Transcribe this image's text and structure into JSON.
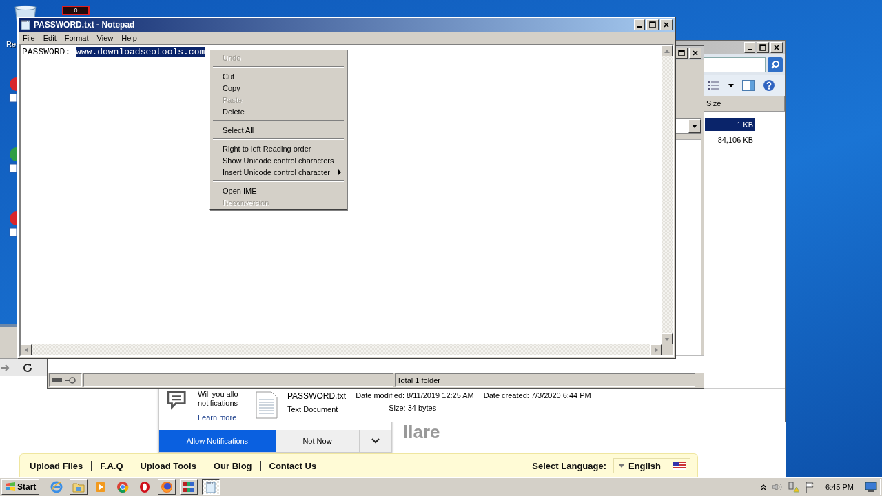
{
  "desktop": {
    "icon_label": "Re",
    "counter": "0"
  },
  "browser": {
    "notification": {
      "lines": [
        "Will you allo",
        "notifications"
      ],
      "link": "Learn more",
      "allow": "Allow Notifications",
      "dismiss": "Not Now"
    },
    "logo_fragment": "llare",
    "nav_links": [
      "Upload Files",
      "F.A.Q",
      "Upload Tools",
      "Our Blog",
      "Contact Us"
    ],
    "language_label": "Select Language:",
    "language": "English"
  },
  "explorer": {
    "column": "Size",
    "rows": [
      {
        "size": "1 KB",
        "selected": true
      },
      {
        "size": "84,106 KB",
        "selected": false
      }
    ],
    "details": {
      "name": "PASSWORD.txt",
      "type": "Text Document",
      "modified": "Date modified: 8/11/2019 12:25 AM",
      "created": "Date created: 7/3/2020 6:44 PM",
      "size": "Size: 34 bytes"
    }
  },
  "folder_window": {
    "status": "Total 1 folder"
  },
  "notepad": {
    "title": "PASSWORD.txt - Notepad",
    "menu": [
      "File",
      "Edit",
      "Format",
      "View",
      "Help"
    ],
    "text": "PASSWORD: ",
    "selection": "www.downloadseotools.com"
  },
  "context_menu": {
    "groups": [
      [
        {
          "label": "Undo",
          "disabled": true,
          "submenu": false
        }
      ],
      [
        {
          "label": "Cut",
          "disabled": false,
          "submenu": false
        },
        {
          "label": "Copy",
          "disabled": false,
          "submenu": false
        },
        {
          "label": "Paste",
          "disabled": true,
          "submenu": false
        },
        {
          "label": "Delete",
          "disabled": false,
          "submenu": false
        }
      ],
      [
        {
          "label": "Select All",
          "disabled": false,
          "submenu": false
        }
      ],
      [
        {
          "label": "Right to left Reading order",
          "disabled": false,
          "submenu": false
        },
        {
          "label": "Show Unicode control characters",
          "disabled": false,
          "submenu": false
        },
        {
          "label": "Insert Unicode control character",
          "disabled": false,
          "submenu": true
        }
      ],
      [
        {
          "label": "Open IME",
          "disabled": false,
          "submenu": false
        },
        {
          "label": "Reconversion",
          "disabled": true,
          "submenu": false
        }
      ]
    ]
  },
  "taskbar": {
    "start": "Start",
    "apps": [
      {
        "kind": "ie",
        "open": false,
        "selected": false
      },
      {
        "kind": "folder",
        "open": true,
        "selected": false
      },
      {
        "kind": "media",
        "open": false,
        "selected": false
      },
      {
        "kind": "chrome",
        "open": false,
        "selected": false
      },
      {
        "kind": "opera",
        "open": false,
        "selected": false
      },
      {
        "kind": "firefox",
        "open": true,
        "selected": false
      },
      {
        "kind": "archive",
        "open": true,
        "selected": false
      },
      {
        "kind": "notepad",
        "open": true,
        "selected": true
      }
    ],
    "clock": "6:45 PM"
  }
}
